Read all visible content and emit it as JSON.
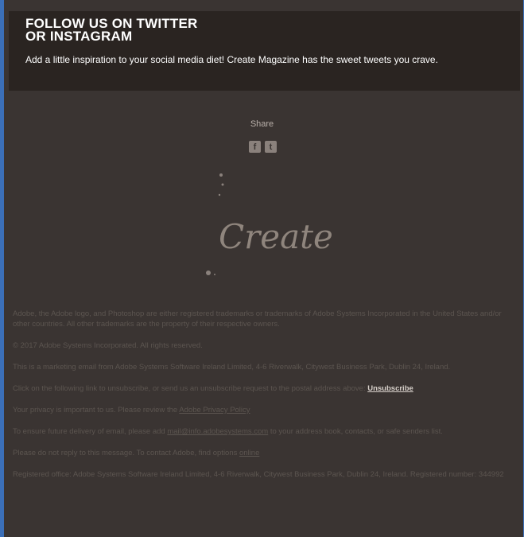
{
  "banner": {
    "title_line1": "FOLLOW US ON TWITTER",
    "title_line2": "OR INSTAGRAM",
    "body": "Add a little inspiration to your social media diet! Create Magazine has the sweet tweets you crave."
  },
  "share": {
    "label": "Share",
    "icons": [
      "facebook-icon",
      "twitter-icon"
    ]
  },
  "logo_text": "Create",
  "legal": {
    "trademarks": "Adobe, the Adobe logo, and Photoshop are either registered trademarks or trademarks of Adobe Systems Incorporated in the United States and/or other countries. All other trademarks are the property of their respective owners.",
    "copyright": "© 2017 Adobe Systems Incorporated. All rights reserved.",
    "marketing": "This is a marketing email from Adobe Systems Software Ireland Limited, 4-6 Riverwalk, Citywest Business Park, Dublin 24, Ireland.",
    "unsubscribe_text": "Click on the following link to unsubscribe, or send us an unsubscribe request to the postal address above:",
    "unsubscribe_link": "Unsubscribe",
    "privacy_text": "Your privacy is important to us. Please review the",
    "privacy_link": "Adobe Privacy Policy",
    "delivery_text_a": "To ensure future delivery of email, please add",
    "delivery_email": "mail@info.adobesystems.com",
    "delivery_text_b": "to your address book, contacts, or safe senders list.",
    "noreply_text": "Please do not reply to this message. To contact Adobe, find options",
    "noreply_link": "online",
    "registered": "Registered office: Adobe Systems Software Ireland Limited, 4-6 Riverwalk, Citywest Business Park, Dublin 24, Ireland. Registered number: 344992"
  }
}
